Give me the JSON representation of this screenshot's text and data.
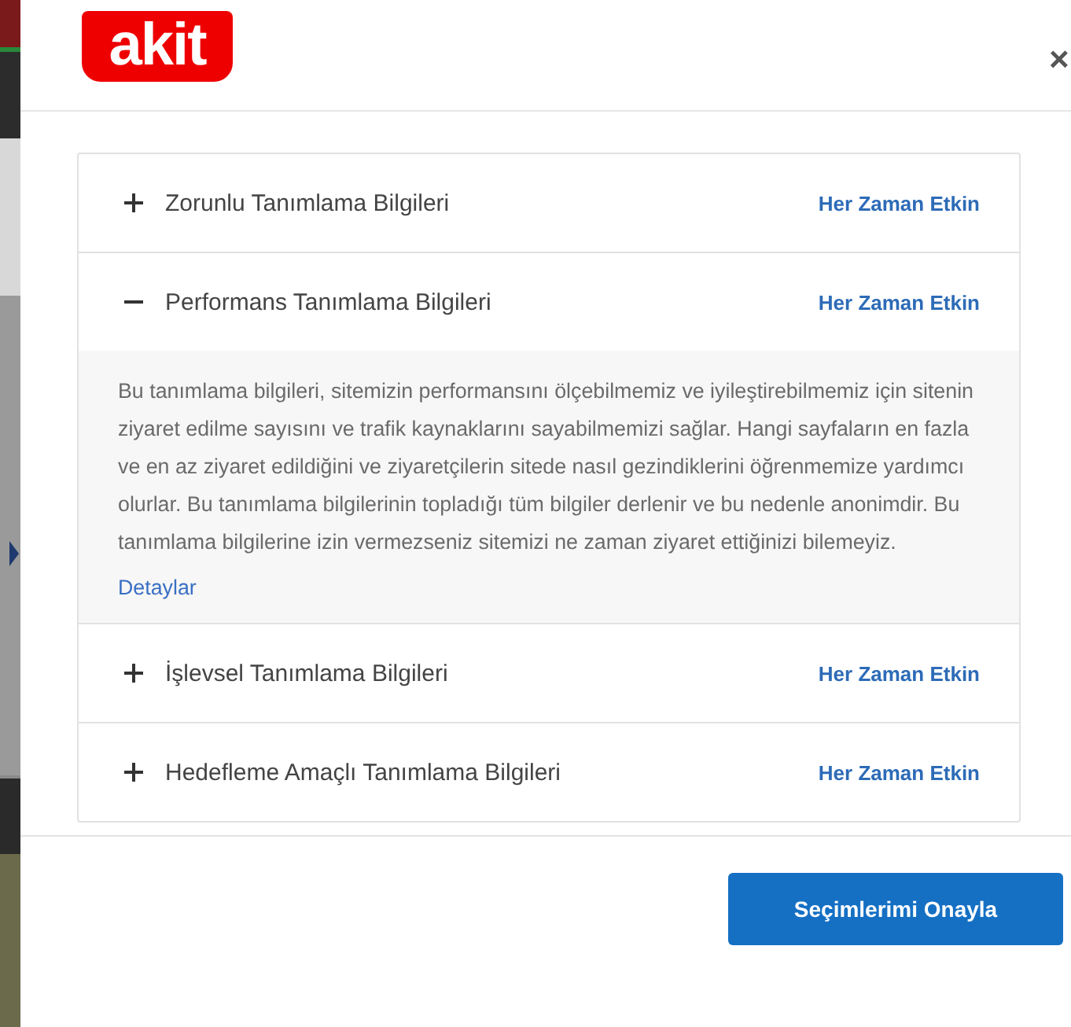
{
  "header": {
    "logo": "akit",
    "close": "×"
  },
  "sections": [
    {
      "title": "Zorunlu Tanımlama Bilgileri",
      "status": "Her Zaman Etkin",
      "expanded": false
    },
    {
      "title": "Performans Tanımlama Bilgileri",
      "status": "Her Zaman Etkin",
      "expanded": true,
      "description": "Bu tanımlama bilgileri, sitemizin performansını ölçebilmemiz ve iyileştirebilmemiz için sitenin ziyaret edilme sayısını ve trafik kaynaklarını sayabilmemizi sağlar. Hangi sayfaların en fazla ve en az ziyaret edildiğini ve ziyaretçilerin sitede nasıl gezindiklerini öğrenmemize yardımcı olurlar. Bu tanımlama bilgilerinin topladığı tüm bilgiler derlenir ve bu nedenle anonimdir. Bu tanımlama bilgilerine izin vermezseniz sitemizi ne zaman ziyaret ettiğinizi bilemeyiz.",
      "link": "Detaylar"
    },
    {
      "title": "İşlevsel Tanımlama Bilgileri",
      "status": "Her Zaman Etkin",
      "expanded": false
    },
    {
      "title": "Hedefleme Amaçlı Tanımlama Bilgileri",
      "status": "Her Zaman Etkin",
      "expanded": false
    }
  ],
  "footer": {
    "button": "Seçimlerimi Onayla"
  }
}
